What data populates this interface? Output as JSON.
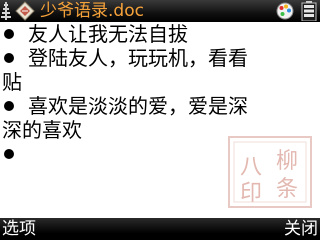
{
  "titlebar": {
    "title": "少爷语录.doc",
    "signal_icon": "signal-strength-icon",
    "app_icon": "document-app-icon",
    "status_icon": "palette-status-icon",
    "battery_icon": "battery-icon",
    "title_color": "#f6a23a"
  },
  "document": {
    "lines": [
      {
        "type": "bullet",
        "text": "友人让我无法自拔"
      },
      {
        "type": "bullet",
        "text": "登陆友人，玩玩机，看看"
      },
      {
        "type": "continuation",
        "text": "贴"
      },
      {
        "type": "bullet",
        "text": "喜欢是淡淡的爱，爱是深"
      },
      {
        "type": "continuation",
        "text": "深的喜欢"
      },
      {
        "type": "bullet",
        "text": ""
      }
    ]
  },
  "softkeys": {
    "left_label": "选项",
    "right_label": "关闭"
  }
}
